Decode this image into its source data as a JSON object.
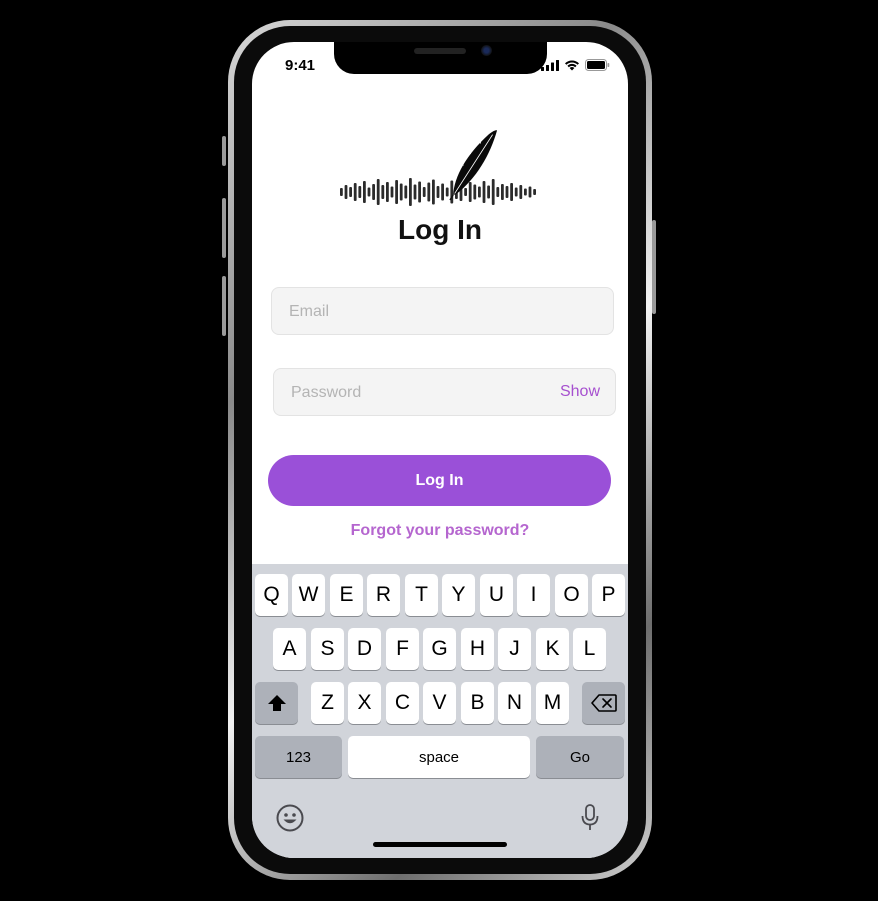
{
  "status_bar": {
    "time": "9:41",
    "icons": [
      "signal-icon",
      "wifi-icon",
      "battery-icon"
    ]
  },
  "logo": {
    "icon": "feather-soundwave-logo"
  },
  "page": {
    "title": "Log In"
  },
  "form": {
    "email_placeholder": "Email",
    "email_value": "",
    "password_placeholder": "Password",
    "password_value": "",
    "show_label": "Show",
    "submit_label": "Log In",
    "forgot_label": "Forgot your password?"
  },
  "keyboard": {
    "row1": [
      "Q",
      "W",
      "E",
      "R",
      "T",
      "Y",
      "U",
      "I",
      "O",
      "P"
    ],
    "row2": [
      "A",
      "S",
      "D",
      "F",
      "G",
      "H",
      "J",
      "K",
      "L"
    ],
    "row3": [
      "Z",
      "X",
      "C",
      "V",
      "B",
      "N",
      "M"
    ],
    "numbers_label": "123",
    "space_label": "space",
    "go_label": "Go",
    "shift_icon": "shift-icon",
    "backspace_icon": "backspace-icon",
    "emoji_icon": "emoji-icon",
    "mic_icon": "microphone-icon"
  },
  "colors": {
    "accent": "#9a50d8",
    "link": "#b566cf",
    "keyboard_bg": "#d1d4da"
  }
}
